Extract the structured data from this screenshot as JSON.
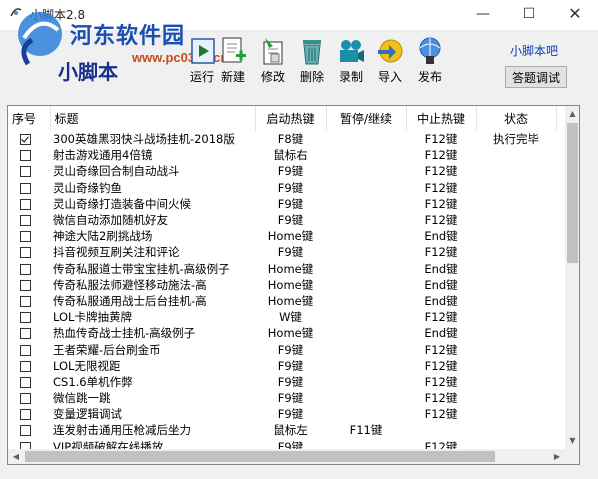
{
  "window": {
    "title": "小脚本2.8",
    "minimize": "—",
    "maximize": "☐",
    "close": "✕"
  },
  "watermark": {
    "site": "河东软件园",
    "url": "www.pc0359.cn"
  },
  "brand": "小脚本",
  "toolbar": [
    {
      "label": "运行",
      "icon": "run-icon"
    },
    {
      "label": "新建",
      "icon": "new-file-icon"
    },
    {
      "label": "修改",
      "icon": "edit-icon"
    },
    {
      "label": "删除",
      "icon": "delete-bin-icon"
    },
    {
      "label": "录制",
      "icon": "record-camera-icon"
    },
    {
      "label": "导入",
      "icon": "import-icon"
    },
    {
      "label": "发布",
      "icon": "publish-globe-icon"
    }
  ],
  "link": "小脚本吧",
  "debug_button": "答题调试",
  "columns": [
    "序号",
    "标题",
    "启动热键",
    "暂停/继续",
    "中止热键",
    "状态"
  ],
  "rows": [
    {
      "checked": true,
      "title": "300英雄黑羽快斗战场挂机-2018版",
      "start": "F8键",
      "pause": "",
      "stop": "F12键",
      "status": "执行完毕"
    },
    {
      "checked": false,
      "title": "射击游戏通用4倍镜",
      "start": "鼠标右",
      "pause": "",
      "stop": "F12键",
      "status": ""
    },
    {
      "checked": false,
      "title": "灵山奇缘回合制自动战斗",
      "start": "F9键",
      "pause": "",
      "stop": "F12键",
      "status": ""
    },
    {
      "checked": false,
      "title": "灵山奇缘钓鱼",
      "start": "F9键",
      "pause": "",
      "stop": "F12键",
      "status": ""
    },
    {
      "checked": false,
      "title": "灵山奇缘打造装备中间火候",
      "start": "F9键",
      "pause": "",
      "stop": "F12键",
      "status": ""
    },
    {
      "checked": false,
      "title": "微信自动添加随机好友",
      "start": "F9键",
      "pause": "",
      "stop": "F12键",
      "status": ""
    },
    {
      "checked": false,
      "title": "神途大陆2刷挑战场",
      "start": "Home键",
      "pause": "",
      "stop": "End键",
      "status": ""
    },
    {
      "checked": false,
      "title": "抖音视频互刷关注和评论",
      "start": "F9键",
      "pause": "",
      "stop": "F12键",
      "status": ""
    },
    {
      "checked": false,
      "title": "传奇私服道士带宝宝挂机-高级例子",
      "start": "Home键",
      "pause": "",
      "stop": "End键",
      "status": ""
    },
    {
      "checked": false,
      "title": "传奇私服法师避怪移动施法-高",
      "start": "Home键",
      "pause": "",
      "stop": "End键",
      "status": ""
    },
    {
      "checked": false,
      "title": "传奇私服通用战士后台挂机-高",
      "start": "Home键",
      "pause": "",
      "stop": "End键",
      "status": ""
    },
    {
      "checked": false,
      "title": "LOL卡牌抽黄牌",
      "start": "W键",
      "pause": "",
      "stop": "F12键",
      "status": ""
    },
    {
      "checked": false,
      "title": "热血传奇战士挂机-高级例子",
      "start": "Home键",
      "pause": "",
      "stop": "End键",
      "status": ""
    },
    {
      "checked": false,
      "title": "王者荣耀-后台刷金币",
      "start": "F9键",
      "pause": "",
      "stop": "F12键",
      "status": ""
    },
    {
      "checked": false,
      "title": "LOL无限视距",
      "start": "F9键",
      "pause": "",
      "stop": "F12键",
      "status": ""
    },
    {
      "checked": false,
      "title": "CS1.6单机作弊",
      "start": "F9键",
      "pause": "",
      "stop": "F12键",
      "status": ""
    },
    {
      "checked": false,
      "title": "微信跳一跳",
      "start": "F9键",
      "pause": "",
      "stop": "F12键",
      "status": ""
    },
    {
      "checked": false,
      "title": "变量逻辑调试",
      "start": "F9键",
      "pause": "",
      "stop": "F12键",
      "status": ""
    },
    {
      "checked": false,
      "title": "连发射击通用压枪减后坐力",
      "start": "鼠标左",
      "pause": "F11键",
      "stop": "",
      "status": ""
    },
    {
      "checked": false,
      "title": "VIP视频破解在线播放",
      "start": "F9键",
      "pause": "",
      "stop": "F12键",
      "status": ""
    }
  ]
}
